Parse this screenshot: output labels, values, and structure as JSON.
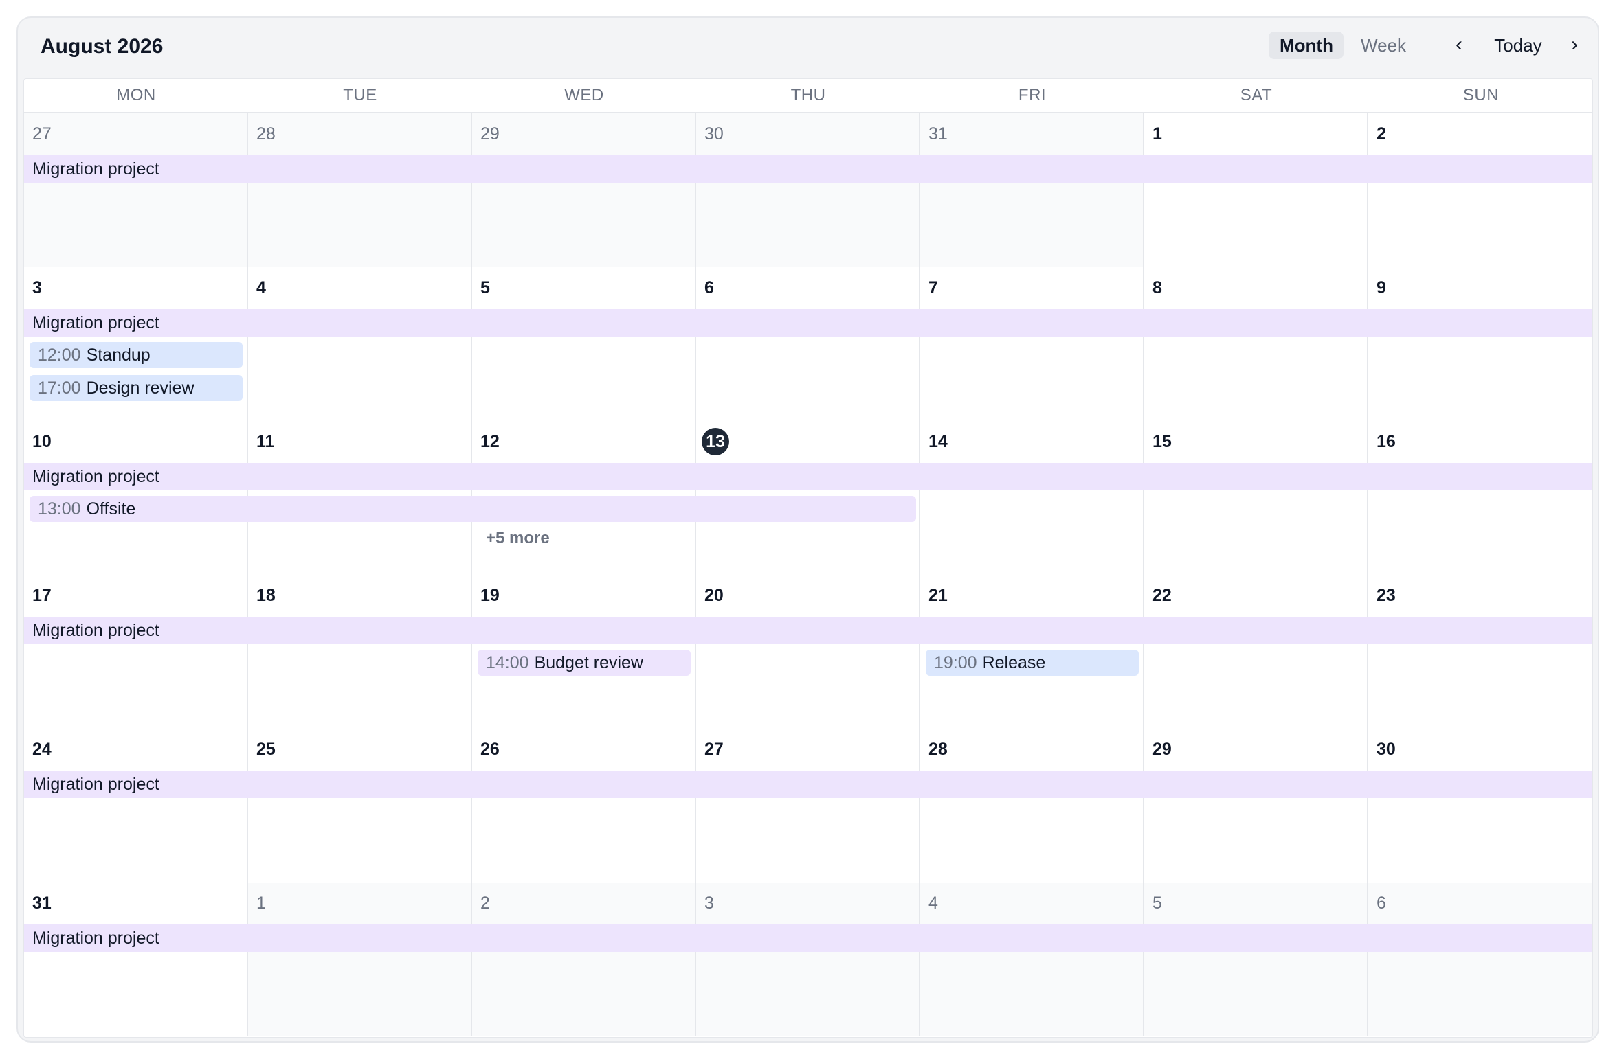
{
  "header": {
    "title": "August 2026",
    "views": {
      "month": "Month",
      "week": "Week",
      "active": "month"
    },
    "nav": {
      "prev": "‹",
      "today": "Today",
      "next": "›"
    }
  },
  "weekdays": [
    "MON",
    "TUE",
    "WED",
    "THU",
    "FRI",
    "SAT",
    "SUN"
  ],
  "spanning_event": "Migration project",
  "today_day": "13",
  "weeks": [
    {
      "days": [
        "27",
        "28",
        "29",
        "30",
        "31",
        "1",
        "2"
      ],
      "outside": [
        true,
        true,
        true,
        true,
        true,
        false,
        false
      ]
    },
    {
      "days": [
        "3",
        "4",
        "5",
        "6",
        "7",
        "8",
        "9"
      ],
      "outside": [
        false,
        false,
        false,
        false,
        false,
        false,
        false
      ]
    },
    {
      "days": [
        "10",
        "11",
        "12",
        "13",
        "14",
        "15",
        "16"
      ],
      "outside": [
        false,
        false,
        false,
        false,
        false,
        false,
        false
      ]
    },
    {
      "days": [
        "17",
        "18",
        "19",
        "20",
        "21",
        "22",
        "23"
      ],
      "outside": [
        false,
        false,
        false,
        false,
        false,
        false,
        false
      ]
    },
    {
      "days": [
        "24",
        "25",
        "26",
        "27",
        "28",
        "29",
        "30"
      ],
      "outside": [
        false,
        false,
        false,
        false,
        false,
        false,
        false
      ]
    },
    {
      "days": [
        "31",
        "1",
        "2",
        "3",
        "4",
        "5",
        "6"
      ],
      "outside": [
        false,
        true,
        true,
        true,
        true,
        true,
        true
      ]
    }
  ],
  "events": {
    "standup": {
      "time": "12:00",
      "title": "Standup"
    },
    "design_review": {
      "time": "17:00",
      "title": "Design review"
    },
    "offsite": {
      "time": "13:00",
      "title": "Offsite"
    },
    "budget_review": {
      "time": "14:00",
      "title": "Budget review"
    },
    "release": {
      "time": "19:00",
      "title": "Release"
    }
  },
  "more_label": "+5 more",
  "colors": {
    "event_blue": "#dbe7fd",
    "event_purple": "#ede4fd",
    "today_badge": "#1f2937"
  }
}
